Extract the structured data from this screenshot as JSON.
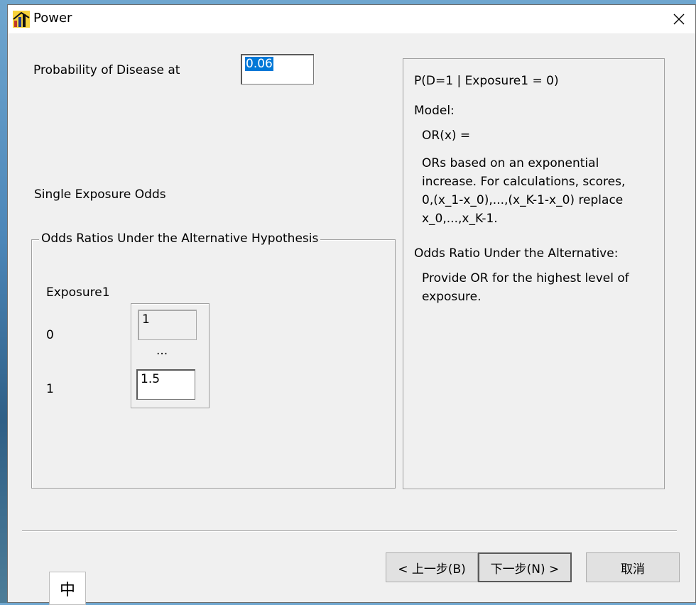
{
  "window": {
    "title": "Power"
  },
  "form": {
    "prob_label": "Probability of Disease at",
    "prob_value": "0.06",
    "single_exposure_label": "Single Exposure Odds",
    "group_title": "Odds Ratios Under the Alternative Hypothesis",
    "exposure_header": "Exposure1",
    "rows": [
      {
        "level": "0",
        "value": "1"
      },
      {
        "level": "1",
        "value": "1.5"
      }
    ],
    "ellipsis": "..."
  },
  "info": {
    "line1": "P(D=1 | Exposure1 = 0)",
    "model_label": "Model:",
    "model_formula": "OR(x) =",
    "model_desc_1": "ORs based on an exponential",
    "model_desc_2": "increase.  For calculations, scores,",
    "model_desc_3": "0,(x_1-x_0),...,(x_K-1-x_0) replace",
    "model_desc_4": "x_0,...,x_K-1.",
    "alt_label": "Odds Ratio Under the Alternative:",
    "alt_desc_1": "Provide OR for the highest level of",
    "alt_desc_2": "exposure."
  },
  "buttons": {
    "back": "< 上一步(B)",
    "next": "下一步(N) >",
    "cancel": "取消"
  },
  "ime": {
    "mode": "中"
  },
  "icons": {
    "app": "bar-chart-icon",
    "close": "close-icon"
  }
}
